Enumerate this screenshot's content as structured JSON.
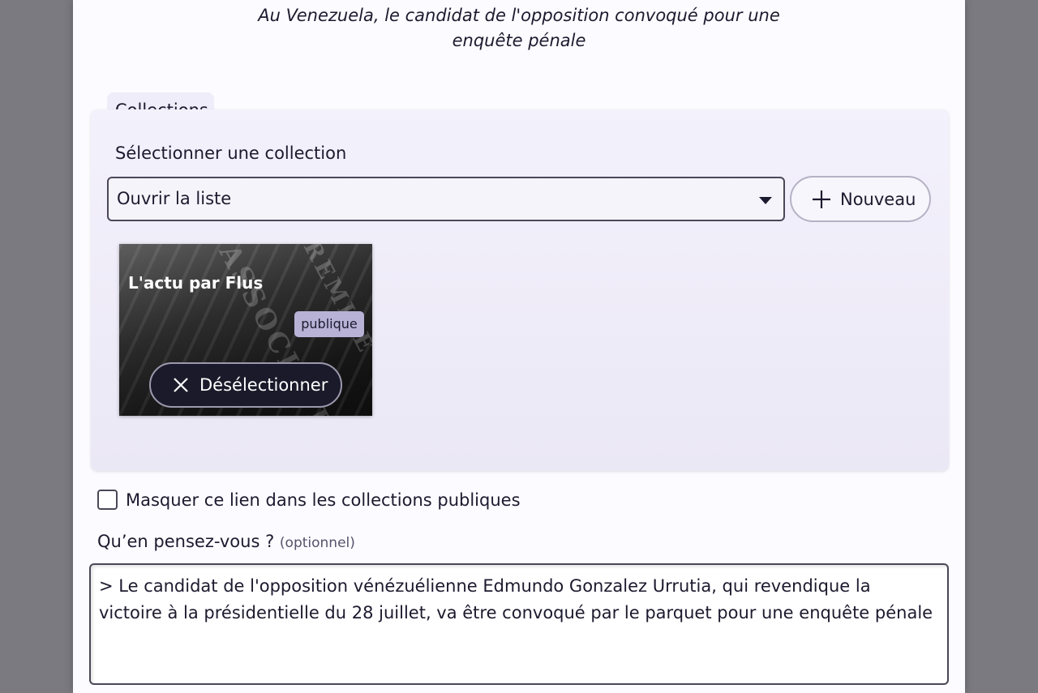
{
  "link": {
    "title_line1": "Au Venezuela, le candidat de l'opposition convoqué pour une",
    "title_line2": "enquête pénale"
  },
  "collections": {
    "legend": "Collections",
    "select_label": "Sélectionner une collection",
    "select_value": "Ouvrir la liste",
    "new_button_label": "Nouveau",
    "new_button_icon": "plus-icon",
    "selected": [
      {
        "title": "L'actu par Flus",
        "badge": "publique",
        "deselect_label": "Désélectionner",
        "deselect_icon": "close-icon"
      }
    ]
  },
  "hide_link": {
    "label": "Masquer ce lien dans les collections publiques",
    "checked": false
  },
  "comment": {
    "label": "Qu’en pensez-vous ?",
    "optional": "(optionnel)",
    "value": "> Le candidat de l'opposition vénézuélienne Edmundo Gonzalez Urrutia, qui revendique la victoire à la présidentielle du 28 juillet, va être convoqué par le parquet pour une enquête pénale"
  },
  "colors": {
    "page_bg": "#7b7a80",
    "panel_bg": "#fcfbff",
    "fieldset_bg": "#efedf9",
    "badge_bg": "#b7b2d6",
    "text": "#1c1a2e"
  }
}
